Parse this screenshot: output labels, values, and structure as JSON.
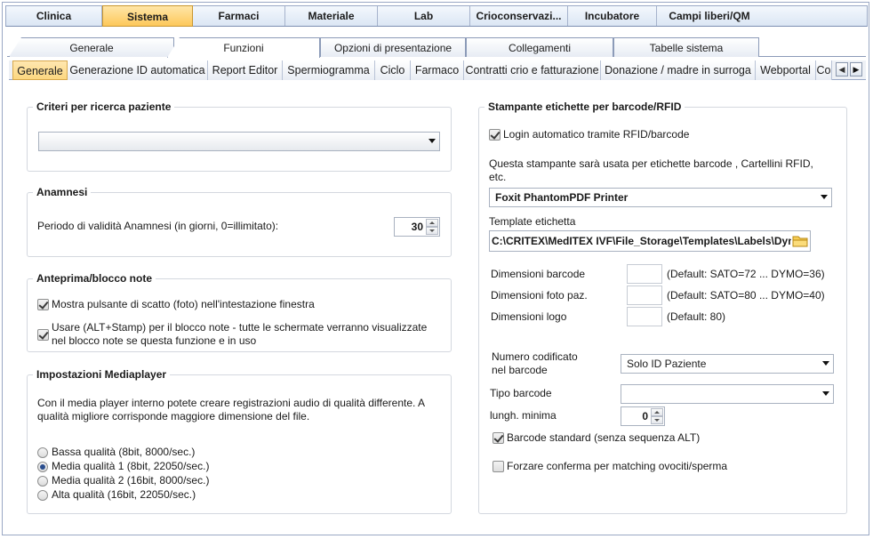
{
  "top_tabs": [
    {
      "label": "Clinica",
      "active": false
    },
    {
      "label": "Sistema",
      "active": true
    },
    {
      "label": "Farmaci",
      "active": false
    },
    {
      "label": "Materiale",
      "active": false
    },
    {
      "label": "Lab",
      "active": false
    },
    {
      "label": "Crioconservazi...",
      "active": false
    },
    {
      "label": "Incubatore",
      "active": false
    },
    {
      "label": "Campi liberi/QM",
      "active": false
    }
  ],
  "section_tabs": [
    {
      "label": "Generale",
      "active": false
    },
    {
      "label": "Funzioni",
      "active": true
    },
    {
      "label": "Opzioni di presentazione",
      "active": false
    },
    {
      "label": "Collegamenti",
      "active": false
    },
    {
      "label": "Tabelle sistema",
      "active": false
    }
  ],
  "sub_tabs": [
    {
      "label": "Generale",
      "active": true
    },
    {
      "label": "Generazione ID automatica",
      "active": false
    },
    {
      "label": "Report Editor",
      "active": false
    },
    {
      "label": "Spermiogramma",
      "active": false
    },
    {
      "label": "Ciclo",
      "active": false
    },
    {
      "label": "Farmaco",
      "active": false
    },
    {
      "label": "Contratti crio e fatturazione",
      "active": false
    },
    {
      "label": "Donazione / madre in surroga",
      "active": false
    },
    {
      "label": "Webportal",
      "active": false
    },
    {
      "label": "Co",
      "active": false
    }
  ],
  "colors": {
    "active_tab": "#fdc85a",
    "active_subtab": "#fcd77f",
    "frame_border": "#9aa8c4",
    "radio_dot": "#2b4e8e"
  },
  "criteri": {
    "title": "Criteri per ricerca paziente",
    "select_value": ""
  },
  "anamnesi": {
    "title": "Anamnesi",
    "label": "Periodo di validità Anamnesi (in giorni, 0=illimitato):",
    "value": "30"
  },
  "anteprima": {
    "title": "Anteprima/blocco note",
    "check1_label": "Mostra pulsante di scatto (foto) nell'intestazione finestra",
    "check1": true,
    "check2_line1": "Usare (ALT+Stamp) per il blocco note - tutte le schermate verranno   visualizzate",
    "check2_line2": "nel blocco note se questa funzione e in uso",
    "check2": true
  },
  "mediaplayer": {
    "title": "Impostazioni Mediaplayer",
    "desc_line1": "Con il media player interno potete creare registrazioni audio di qualità differente. A",
    "desc_line2": "qualità migliore corrisponde maggiore dimensione del file.",
    "options": [
      {
        "label": "Bassa qualità (8bit, 8000/sec.)",
        "selected": false
      },
      {
        "label": "Media qualità 1 (8bit, 22050/sec.)",
        "selected": true
      },
      {
        "label": "Media qualità 2 (16bit, 8000/sec.)",
        "selected": false
      },
      {
        "label": "Alta qualità (16bit, 22050/sec.)",
        "selected": false
      }
    ]
  },
  "stampante": {
    "title": "Stampante etichette per barcode/RFID",
    "login_label": "Login automatico tramite RFID/barcode",
    "login_checked": true,
    "desc_line1": "Questa stampante sarà usata per etichette barcode , Cartellini RFID,",
    "desc_line2": "etc.",
    "printer_value": "Foxit PhantomPDF Printer",
    "template_label": "Template etichetta",
    "template_value": "C:\\CRITEX\\MedITEX IVF\\File_Storage\\Templates\\Labels\\Dymo",
    "folder_icon": "folder-icon",
    "dim_barcode_label": "Dimensioni barcode",
    "dim_barcode_default": "(Default: SATO=72 ... DYMO=36)",
    "dim_foto_label": "Dimensioni foto paz.",
    "dim_foto_default": "(Default: SATO=80 ... DYMO=40)",
    "dim_logo_label": "Dimensioni logo",
    "dim_logo_default": "(Default: 80)",
    "numero_label_line1": "Numero codificato",
    "numero_label_line2": "nel barcode",
    "numero_value": "Solo ID Paziente",
    "tipo_label": "Tipo barcode",
    "tipo_value": "",
    "lungh_label": "lungh. minima",
    "lungh_value": "0",
    "standard_label": "Barcode standard (senza sequenza ALT)",
    "standard_checked": true,
    "forzare_label": "Forzare conferma per matching ovociti/sperma",
    "forzare_checked": false
  }
}
